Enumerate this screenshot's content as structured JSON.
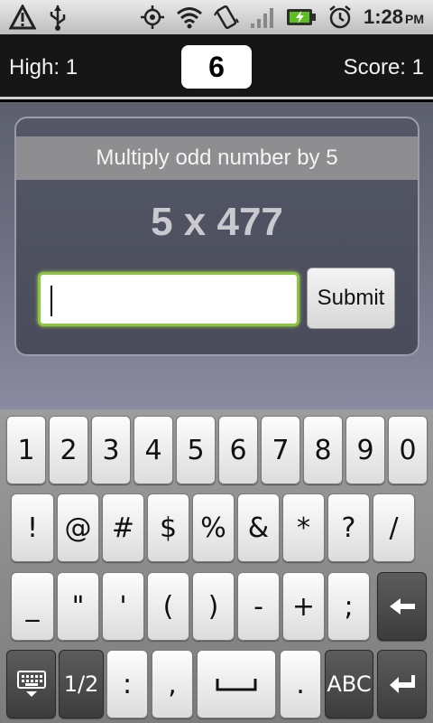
{
  "status_bar": {
    "time": "1:28",
    "ampm": "PM",
    "icons": [
      "warning-icon",
      "usb-icon",
      "gps-icon",
      "wifi-icon",
      "vibrate-icon",
      "signal-icon",
      "battery-charging-icon",
      "alarm-icon"
    ]
  },
  "header": {
    "high_label": "High: 1",
    "level": "6",
    "score_label": "Score: 1"
  },
  "game": {
    "task": "Multiply odd number by 5",
    "problem": "5 x 477",
    "answer_value": "",
    "submit_label": "Submit"
  },
  "keyboard": {
    "row1": [
      "1",
      "2",
      "3",
      "4",
      "5",
      "6",
      "7",
      "8",
      "9",
      "0"
    ],
    "row2": [
      "!",
      "@",
      "#",
      "$",
      "%",
      "&",
      "*",
      "?",
      "/"
    ],
    "row3": [
      "_",
      "\"",
      "'",
      "(",
      ")",
      "-",
      "+",
      ";"
    ],
    "row4": {
      "keyboard_settings_icon": "keyboard-icon",
      "page": "1/2",
      "colon": ":",
      "comma": ",",
      "space_icon": "space-icon",
      "period": ".",
      "abc": "ABC",
      "backspace_icon": "backspace-icon",
      "enter_icon": "enter-icon"
    }
  }
}
